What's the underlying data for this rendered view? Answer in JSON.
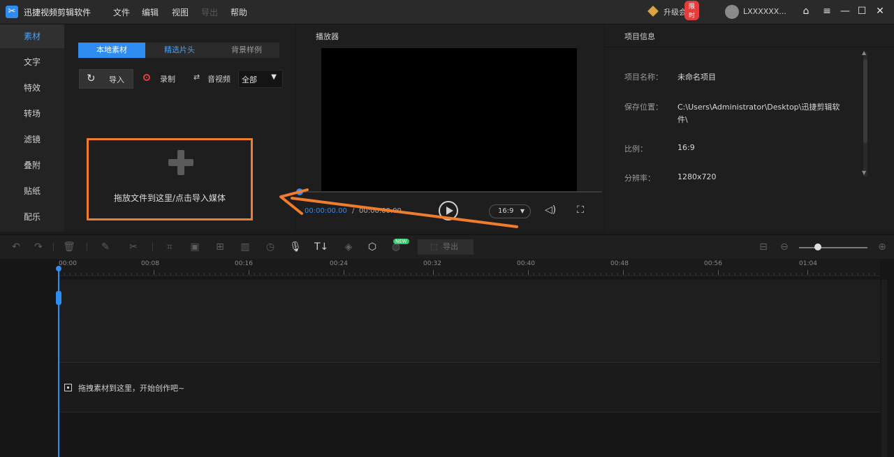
{
  "app": {
    "title": "迅捷视频剪辑软件",
    "logo_icon": "scissors-icon",
    "vip_label": "升级会员",
    "vip_badge": "限时",
    "username": "LXXXXXX..."
  },
  "menu": [
    {
      "label": "文件"
    },
    {
      "label": "编辑"
    },
    {
      "label": "视图"
    },
    {
      "label": "导出"
    },
    {
      "label": "帮助"
    }
  ],
  "window_controls": {
    "home_icon": "⌂",
    "menu_icon": "≡",
    "min_icon": "—",
    "max_icon": "☐",
    "close_icon": "✕"
  },
  "sidebar": {
    "items": [
      {
        "label": "素材"
      },
      {
        "label": "文字"
      },
      {
        "label": "特效"
      },
      {
        "label": "转场"
      },
      {
        "label": "滤镜"
      },
      {
        "label": "叠附"
      },
      {
        "label": "贴纸"
      },
      {
        "label": "配乐"
      }
    ],
    "active_index": 0,
    "active_color": "#4aa0f8"
  },
  "material": {
    "tabs": [
      {
        "label": "本地素材"
      },
      {
        "label": "精选片头"
      },
      {
        "label": "背景样例"
      }
    ],
    "import_label": "导入",
    "record_label": "录制",
    "extract_label": "音视频",
    "filter_value": "全部",
    "drop_text": "拖放文件到这里/点击导入媒体",
    "highlight_color": "#f07c2e"
  },
  "player": {
    "title": "播放器",
    "current_time": "00:00:00.00",
    "separator": "/",
    "total_time": "00:00:00.00",
    "ratio": "16:9"
  },
  "project_info": {
    "title": "项目信息",
    "fields": [
      {
        "label": "项目名称：",
        "value": "未命名项目"
      },
      {
        "label": "保存位置：",
        "value": "C:\\Users\\Administrator\\Desktop\\迅捷剪辑软",
        "value2": "件\\"
      },
      {
        "label": "比例：",
        "value": "16:9"
      },
      {
        "label": "分辨率：",
        "value": "1280x720"
      }
    ]
  },
  "toolbar": {
    "new_badge": "NEW",
    "export_label": "导出",
    "export_icon": "export-icon"
  },
  "timeline": {
    "ticks": [
      "00:00",
      "00:08",
      "00:16",
      "00:24",
      "00:32",
      "00:40",
      "00:48",
      "00:56",
      "01:04"
    ],
    "hint": "拖拽素材到这里，开始创作吧~",
    "playhead_color": "#2f8cf0"
  }
}
